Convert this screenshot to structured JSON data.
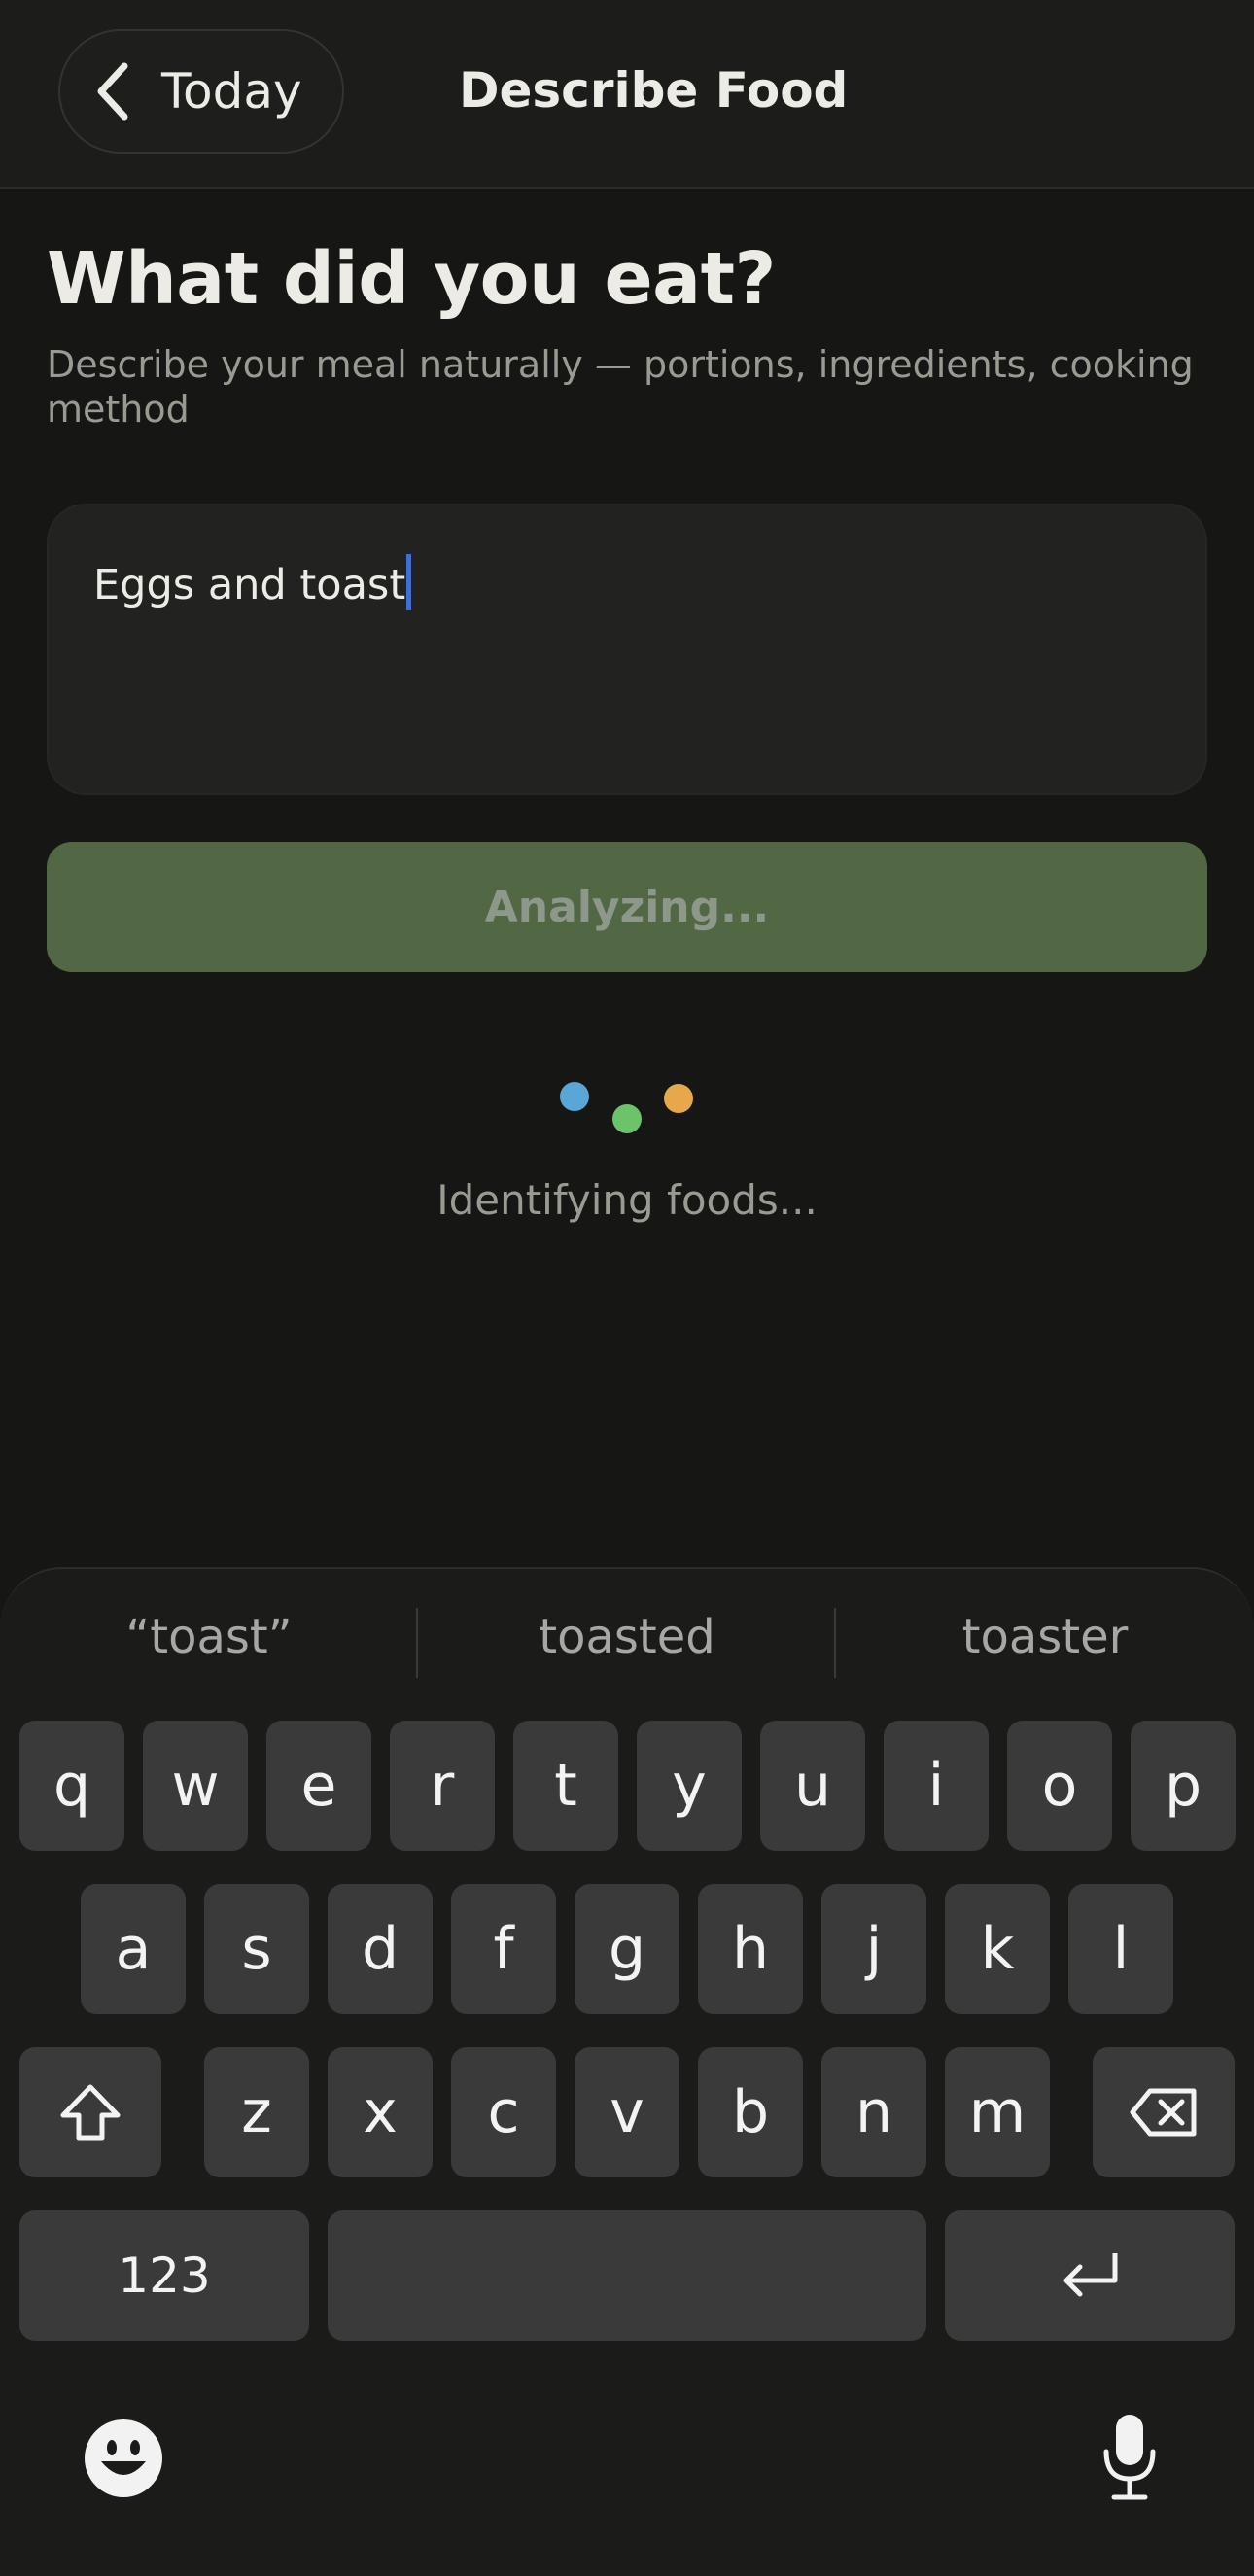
{
  "header": {
    "back_label": "Today",
    "title": "Describe Food"
  },
  "main": {
    "heading": "What did you eat?",
    "subtitle": "Describe your meal naturally — portions, ingredients, cooking method",
    "input_value": "Eggs and toast",
    "button_label": "Analyzing...",
    "status_text": "Identifying foods...",
    "dot_colors": [
      "#5aa6d6",
      "#6cc36a",
      "#e6a84a"
    ]
  },
  "keyboard": {
    "suggestions": [
      "“toast”",
      "toasted",
      "toaster"
    ],
    "row1": [
      "q",
      "w",
      "e",
      "r",
      "t",
      "y",
      "u",
      "i",
      "o",
      "p"
    ],
    "row2": [
      "a",
      "s",
      "d",
      "f",
      "g",
      "h",
      "j",
      "k",
      "l"
    ],
    "row3": [
      "z",
      "x",
      "c",
      "v",
      "b",
      "n",
      "m"
    ],
    "numbers_label": "123"
  },
  "colors": {
    "background": "#161714",
    "accent_button": "#526743",
    "caret": "#3f6fd6"
  }
}
